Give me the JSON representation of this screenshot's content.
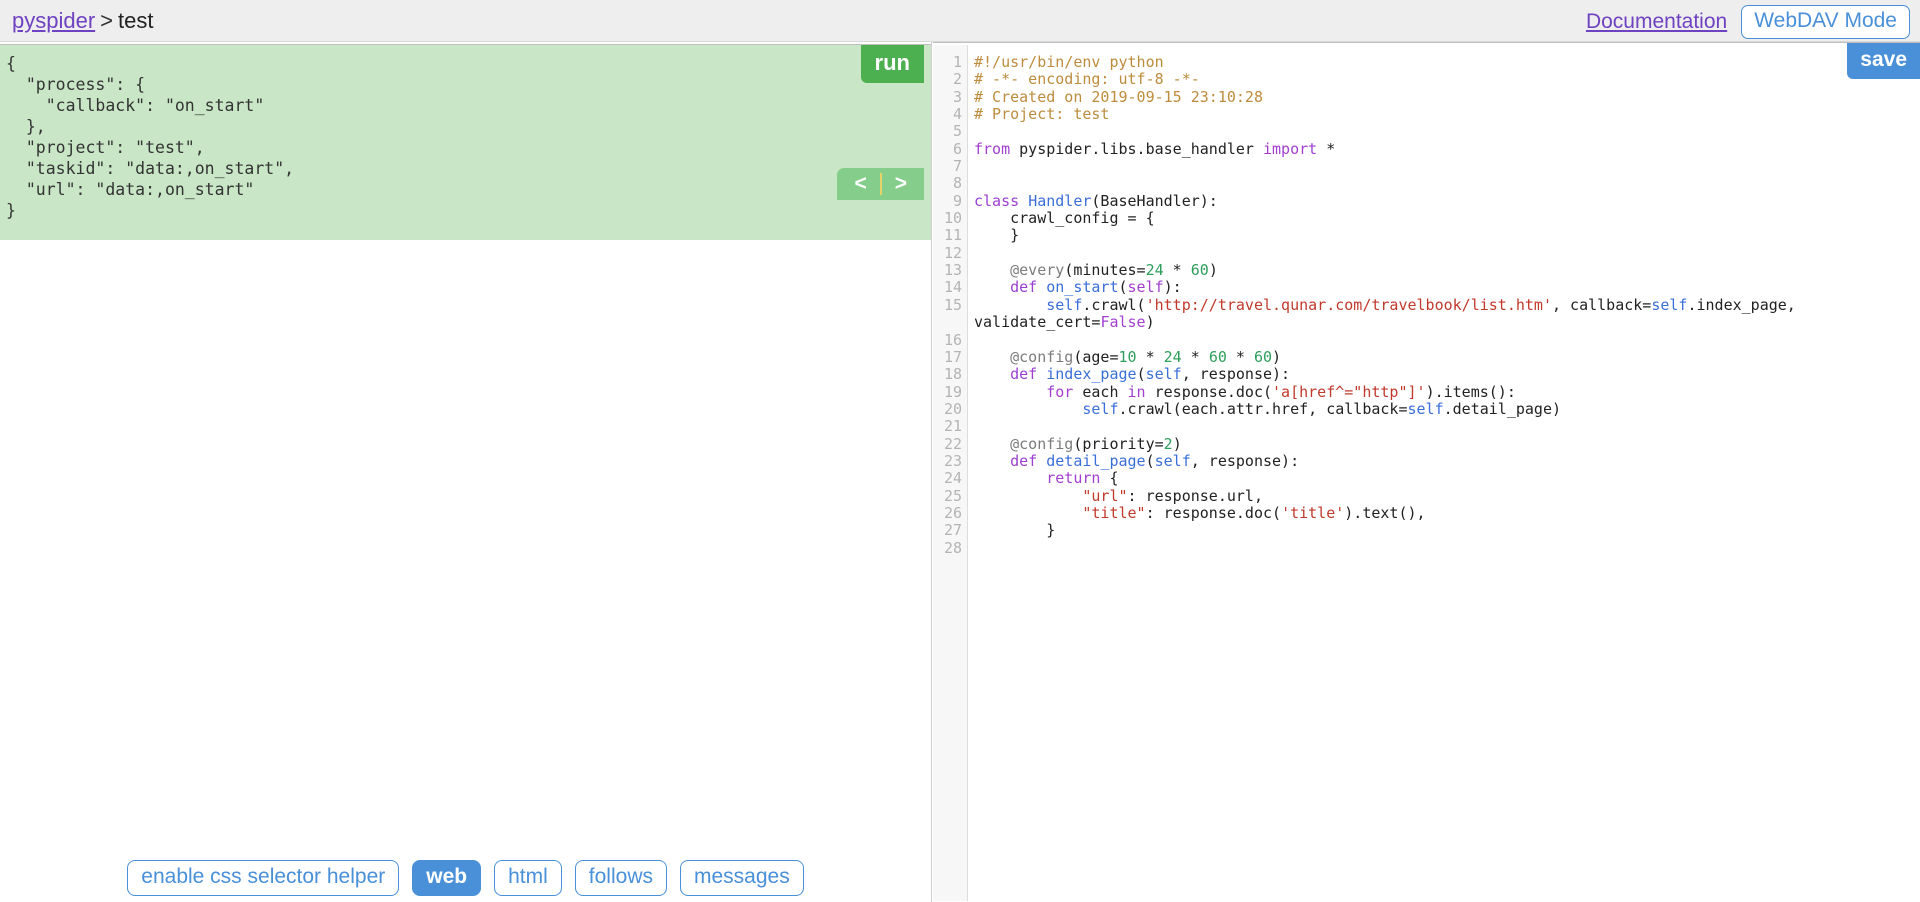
{
  "header": {
    "breadcrumb_root": "pyspider",
    "breadcrumb_separator": ">",
    "breadcrumb_current": "test",
    "documentation_label": "Documentation",
    "webdav_label": "WebDAV Mode"
  },
  "left": {
    "run_label": "run",
    "prev_label": "<",
    "next_label": ">",
    "task_json": "{\n  \"process\": {\n    \"callback\": \"on_start\"\n  },\n  \"project\": \"test\",\n  \"taskid\": \"data:,on_start\",\n  \"url\": \"data:,on_start\"\n}",
    "buttons": [
      {
        "label": "enable css selector helper",
        "active": false
      },
      {
        "label": "web",
        "active": true
      },
      {
        "label": "html",
        "active": false
      },
      {
        "label": "follows",
        "active": false
      },
      {
        "label": "messages",
        "active": false
      }
    ]
  },
  "right": {
    "save_label": "save",
    "line_numbers": "1\n2\n3\n4\n5\n6\n7\n8\n9\n10\n11\n12\n13\n14\n15\n\n16\n17\n18\n19\n20\n21\n22\n23\n24\n25\n26\n27\n28",
    "line_count": 28,
    "code_lines": [
      "#!/usr/bin/env python",
      "# -*- encoding: utf-8 -*-",
      "# Created on 2019-09-15 23:10:28",
      "# Project: test",
      "",
      "from pyspider.libs.base_handler import *",
      "",
      "",
      "class Handler(BaseHandler):",
      "    crawl_config = {",
      "    }",
      "",
      "    @every(minutes=24 * 60)",
      "    def on_start(self):",
      "        self.crawl('http://travel.qunar.com/travelbook/list.htm', callback=self.index_page, validate_cert=False)",
      "",
      "    @config(age=10 * 24 * 60 * 60)",
      "    def index_page(self, response):",
      "        for each in response.doc('a[href^=\"http\"]').items():",
      "            self.crawl(each.attr.href, callback=self.detail_page)",
      "",
      "    @config(priority=2)",
      "    def detail_page(self, response):",
      "        return {",
      "            \"url\": response.url,",
      "            \"title\": response.doc('title').text(),",
      "        }",
      ""
    ],
    "crawl_url": "http://travel.qunar.com/travelbook/list.htm",
    "created_on": "2019-09-15 23:10:28",
    "project_name": "test"
  },
  "colors": {
    "accent_blue": "#4a90d9",
    "run_green": "#4caf50",
    "task_bg_green": "#c9e6c7",
    "link_purple": "#6f42c1",
    "header_bg": "#eeeeee"
  }
}
